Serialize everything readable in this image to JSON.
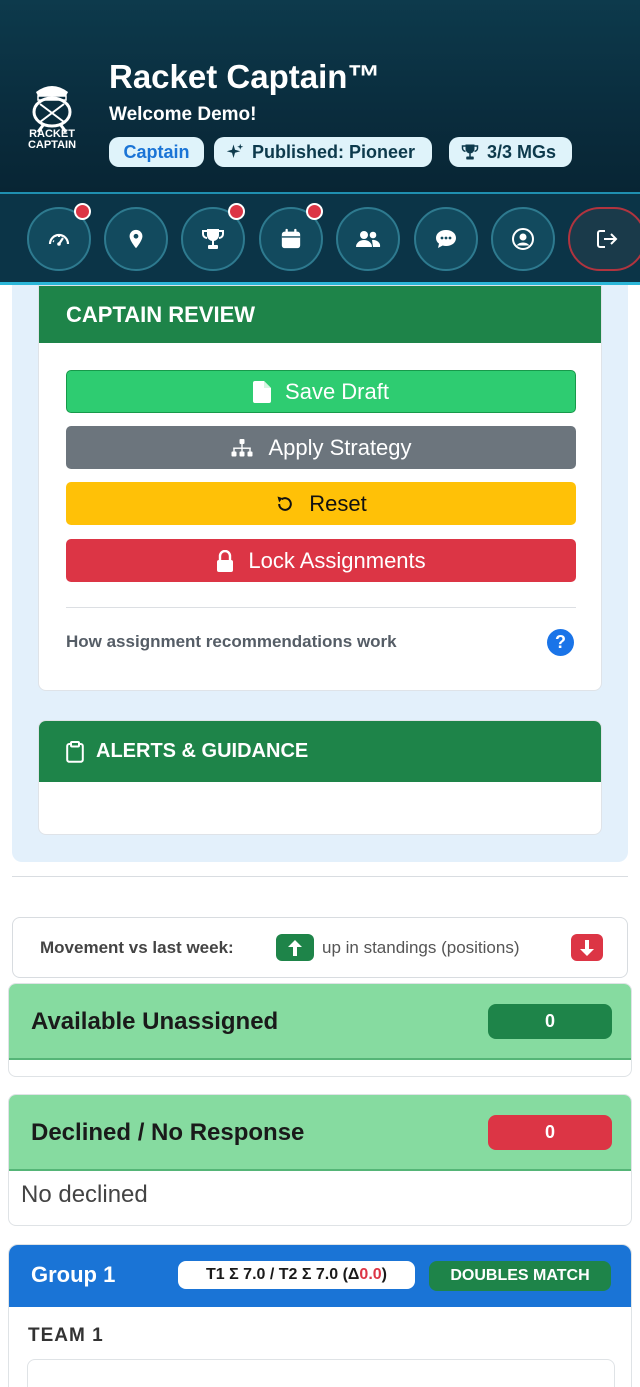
{
  "header": {
    "logo_text_line1": "RACKET",
    "logo_text_line2": "CAPTAIN",
    "logo_tm": "™",
    "title": "Racket Captain™",
    "welcome": "Welcome Demo!",
    "badges": {
      "role": "Captain",
      "published": "Published: Pioneer",
      "mgs": "3/3 MGs"
    }
  },
  "nav": {
    "items": [
      {
        "icon": "dashboard-gauge-icon",
        "has_alert": true
      },
      {
        "icon": "location-pin-icon",
        "has_alert": false
      },
      {
        "icon": "trophy-icon",
        "has_alert": true
      },
      {
        "icon": "calendar-icon",
        "has_alert": true
      },
      {
        "icon": "users-icon",
        "has_alert": false
      },
      {
        "icon": "chat-icon",
        "has_alert": false
      },
      {
        "icon": "profile-icon",
        "has_alert": false
      },
      {
        "icon": "logout-icon",
        "has_alert": false
      }
    ]
  },
  "captain_review": {
    "title": "CAPTAIN REVIEW",
    "save_draft": "Save Draft",
    "apply_strategy": "Apply Strategy",
    "reset": "Reset",
    "lock_assignments": "Lock Assignments",
    "help_text": "How assignment recommendations work",
    "help_icon": "?"
  },
  "alerts": {
    "title": "ALERTS & GUIDANCE"
  },
  "movement": {
    "label": "Movement vs last week:",
    "up_text": "up in standings (positions)"
  },
  "available": {
    "title": "Available Unassigned",
    "count": "0"
  },
  "declined": {
    "title": "Declined / No Response",
    "count": "0",
    "empty_text": "No declined"
  },
  "group": {
    "title": "Group 1",
    "sum_prefix": "T1 Σ 7.0 / T2 Σ 7.0 (Δ",
    "sum_delta": "0.0",
    "sum_suffix": ")",
    "match_type": "DOUBLES MATCH",
    "team_label": "TEAM 1"
  },
  "colors": {
    "header_bg": "#0b3447",
    "primary_green": "#1e8449",
    "save_green": "#2ecc71",
    "strategy_gray": "#6c757d",
    "reset_yellow": "#ffc107",
    "lock_red": "#dc3545",
    "group_blue": "#1a74d6",
    "status_green": "#86dba0",
    "review_bg": "#e3f0fb"
  }
}
